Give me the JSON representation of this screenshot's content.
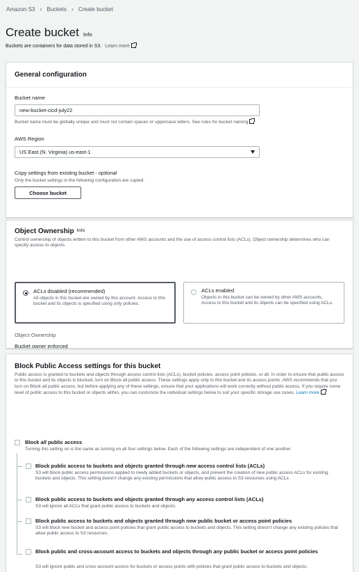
{
  "breadcrumb": [
    "Amazon S3",
    "Buckets",
    "Create bucket"
  ],
  "page": {
    "title": "Create bucket",
    "info": "Info",
    "description": "Buckets are containers for data stored in S3.",
    "learn_more": "Learn more"
  },
  "general": {
    "title": "General configuration",
    "bucket_name_label": "Bucket name",
    "bucket_name_value": "new-bucket-cicd-july22",
    "bucket_name_hint": "Bucket name must be globally unique and must not contain spaces or uppercase letters. See rules for bucket naming",
    "region_label": "AWS Region",
    "region_value": "US East (N. Virginia) us-east-1",
    "copy_label": "Copy settings from existing bucket",
    "copy_optional": "optional",
    "copy_hint": "Only the bucket settings in the following configuration are copied.",
    "choose_button": "Choose bucket"
  },
  "ownership": {
    "title": "Object Ownership",
    "info": "Info",
    "description": "Control ownership of objects written to this bucket from other AWS accounts and the use of access control lists (ACLs). Object ownership determines who can specify access to objects.",
    "options": [
      {
        "title": "ACLs disabled (recommended)",
        "desc": "All objects in this bucket are owned by this account. Access to this bucket and its objects is specified using only policies.",
        "selected": true
      },
      {
        "title": "ACLs enabled",
        "desc": "Objects in this bucket can be owned by other AWS accounts. Access to this bucket and its objects can be specified using ACLs.",
        "selected": false
      }
    ],
    "field_label": "Object Ownership",
    "field_value": "Bucket owner enforced"
  },
  "bpa": {
    "title": "Block Public Access settings for this bucket",
    "description": "Public access is granted to buckets and objects through access control lists (ACLs), bucket policies, access point policies, or all. In order to ensure that public access to this bucket and its objects is blocked, turn on Block all public access. These settings apply only to this bucket and its access points. AWS recommends that you turn on Block all public access, but before applying any of these settings, ensure that your applications will work correctly without public access. If you require some level of public access to this bucket or objects within, you can customize the individual settings below to suit your specific storage use cases.",
    "learn_more": "Learn more",
    "all": {
      "title_pre": "Block ",
      "title_em": "all",
      "title_post": " public access",
      "desc": "Turning this setting on is the same as turning on all four settings below. Each of the following settings are independent of one another."
    },
    "items": [
      {
        "pre": "Block public access to buckets and objects granted through ",
        "em": "new",
        "post": " access control lists (ACLs)",
        "desc": "S3 will block public access permissions applied to newly added buckets or objects, and prevent the creation of new public access ACLs for existing buckets and objects. This setting doesn't change any existing permissions that allow public access to S3 resources using ACLs."
      },
      {
        "pre": "Block public access to buckets and objects granted through ",
        "em": "any",
        "post": " access control lists (ACLs)",
        "desc": "S3 will ignore all ACLs that grant public access to buckets and objects."
      },
      {
        "pre": "Block public access to buckets and objects granted through ",
        "em": "new",
        "post": " public bucket or access point policies",
        "desc": "S3 will block new bucket and access point policies that grant public access to buckets and objects. This setting doesn't change any existing policies that allow public access to S3 resources."
      },
      {
        "pre": "Block public and cross-account access to buckets and objects through ",
        "em": "any",
        "post": " public bucket or access point policies",
        "desc": "S3 will ignore public and cross-account access for buckets or access points with policies that grant public access to buckets and objects."
      }
    ]
  }
}
